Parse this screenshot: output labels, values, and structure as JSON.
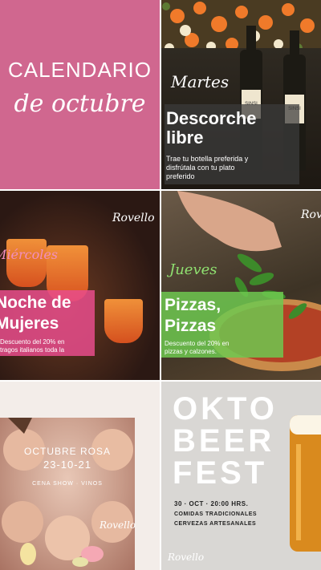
{
  "tile1": {
    "title": "CALENDARIO",
    "subtitle": "de octubre"
  },
  "tile2": {
    "day": "Martes",
    "title_line1": "Descorche",
    "title_line2": "libre",
    "desc_line1": "Trae tu botella preferida y",
    "desc_line2": "disfrútala con tu plato",
    "desc_line3": "preferido",
    "bottle_label": "SINSI"
  },
  "tile3": {
    "day": "Miércoles",
    "title_line1": "Noche de",
    "title_line2": "Mujeres",
    "desc_line1": "Descuento del 20% en",
    "desc_line2": "tragos italianos toda la",
    "logo": "Rovello"
  },
  "tile4": {
    "day": "Jueves",
    "title_line1": "Pizzas,",
    "title_line2": "Pizzas",
    "desc_line1": "Descuento del 20% en",
    "desc_line2": "pizzas  y calzones.",
    "logo": "Rovello"
  },
  "tile5": {
    "title": "OCTUBRE ROSA",
    "date": "23-10-21",
    "sub": "CENA SHOW · VINOS",
    "logo": "Rovello"
  },
  "tile6": {
    "line1": "OKTO",
    "line2": "BEER",
    "line3": "FEST",
    "date_line": "30 · OCT · 20:00 HRS.",
    "info1": "COMIDAS TRADICIONALES",
    "info2": "CERVEZAS ARTESANALES",
    "logo": "Rovello"
  },
  "colors": {
    "pink": "#d0678f",
    "hotpink": "#e84c8c",
    "green": "#6ec850",
    "gray_panel": "#3c3c3c"
  }
}
